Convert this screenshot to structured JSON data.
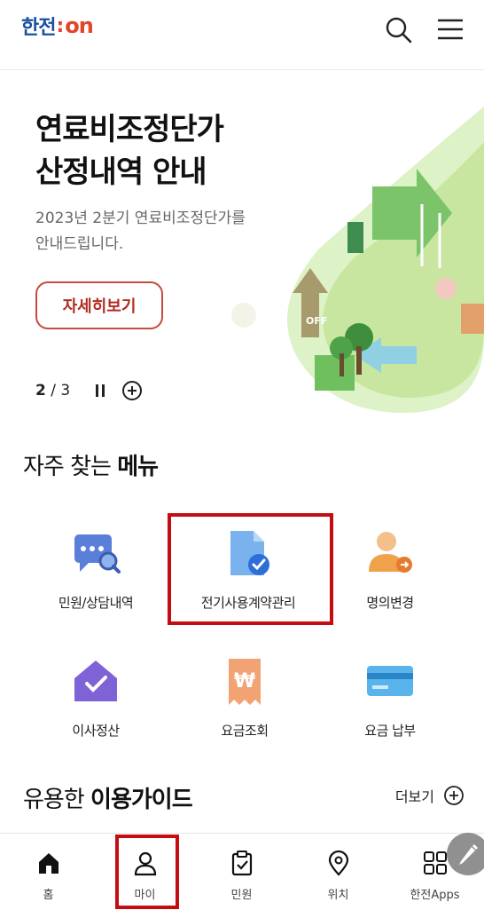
{
  "header": {
    "logo_korean": "한전",
    "logo_colon": ":",
    "logo_on": "on",
    "search_icon": "search-icon",
    "menu_icon": "hamburger-menu-icon"
  },
  "banner": {
    "title_line1": "연료비조정단가",
    "title_line2": "산정내역 안내",
    "desc_line1": "2023년 2분기 연료비조정단가를",
    "desc_line2": "안내드립니다.",
    "detail_button": "자세히보기",
    "pager_current": "2",
    "pager_separator": " / ",
    "pager_total": "3",
    "illustration_text": "OFF"
  },
  "frequent_menu": {
    "title_normal": "자주 찾는 ",
    "title_bold": "메뉴",
    "items": [
      {
        "label": "민원/상담내역",
        "icon": "chat-search-icon"
      },
      {
        "label": "전기사용계약관리",
        "icon": "document-check-icon"
      },
      {
        "label": "명의변경",
        "icon": "person-change-icon"
      },
      {
        "label": "이사정산",
        "icon": "house-check-icon"
      },
      {
        "label": "요금조회",
        "icon": "won-receipt-icon"
      },
      {
        "label": "요금 납부",
        "icon": "credit-card-icon"
      }
    ]
  },
  "guide": {
    "title_normal": "유용한 ",
    "title_bold": "이용가이드",
    "more_label": "더보기"
  },
  "tabbar": {
    "items": [
      {
        "label": "홈",
        "icon": "home-icon"
      },
      {
        "label": "마이",
        "icon": "person-icon"
      },
      {
        "label": "민원",
        "icon": "clipboard-check-icon"
      },
      {
        "label": "위치",
        "icon": "location-pin-icon"
      },
      {
        "label": "한전Apps",
        "icon": "apps-grid-icon"
      }
    ]
  },
  "colors": {
    "brand_blue": "#1a4fa0",
    "brand_red": "#e2452a",
    "highlight_red": "#c30d11",
    "illustration_green": "#c8e6a0"
  }
}
